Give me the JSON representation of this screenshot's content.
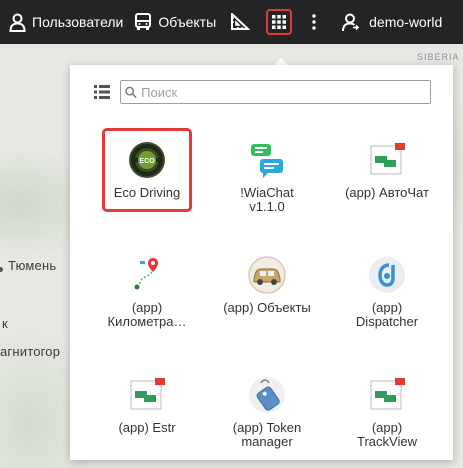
{
  "topbar": {
    "users_label": "Пользователи",
    "units_label": "Объекты",
    "account_label": "demo-world",
    "icons": {
      "users": "user-icon",
      "units": "bus-icon",
      "measure": "ruler-triangle-icon",
      "apps": "grid-apps-icon",
      "more": "vertical-dots-icon",
      "account": "user-switch-icon"
    }
  },
  "map": {
    "labels": [
      "SIBERIA",
      "Тюмень",
      "к",
      "агнитогор"
    ]
  },
  "panel": {
    "search_placeholder": "Поиск",
    "apps": [
      {
        "name": "Eco Driving",
        "icon": "eco-driving-icon",
        "selected": true
      },
      {
        "name": "!WiaChat v1.1.0",
        "icon": "chat-bubbles-icon",
        "selected": false
      },
      {
        "name": "(app) АвтоЧат",
        "icon": "generic-app-icon",
        "selected": false
      },
      {
        "name": "(app) Километра…",
        "icon": "route-pin-icon",
        "selected": false
      },
      {
        "name": "(app) Объекты",
        "icon": "car-icon",
        "selected": false
      },
      {
        "name": "(app) Dispatcher",
        "icon": "dispatcher-icon",
        "selected": false
      },
      {
        "name": "(app) Estr",
        "icon": "generic-app-icon",
        "selected": false
      },
      {
        "name": "(app) Token manager",
        "icon": "token-tag-icon",
        "selected": false
      },
      {
        "name": "(app) TrackView",
        "icon": "generic-app-icon",
        "selected": false
      }
    ]
  },
  "colors": {
    "topbar_bg": "#222426",
    "highlight": "#e53935",
    "panel_bg": "#ffffff"
  }
}
